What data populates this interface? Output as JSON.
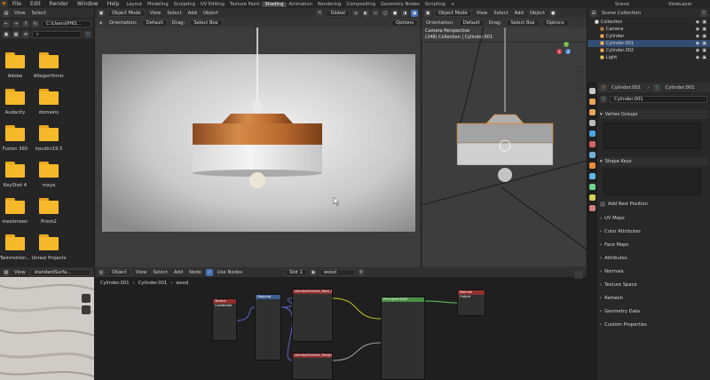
{
  "topbar": {
    "menus": [
      "File",
      "Edit",
      "Render",
      "Window",
      "Help"
    ],
    "workspaces": [
      "Layout",
      "Modeling",
      "Sculpting",
      "UV Editing",
      "Texture Paint",
      "Shading",
      "Animation",
      "Rendering",
      "Compositing",
      "Geometry Nodes",
      "Scripting"
    ],
    "active_workspace": "Shading",
    "add_tab": "+",
    "scene_label": "Scene",
    "viewlayer_label": "ViewLayer"
  },
  "filebrowser": {
    "menus": [
      "View",
      "Select"
    ],
    "path": "C:\\Users\\PHO...",
    "items": [
      {
        "label": "Adobe"
      },
      {
        "label": "Allegorithmic"
      },
      {
        "label": "Audacity"
      },
      {
        "label": "domains"
      },
      {
        "label": "Fusion 360"
      },
      {
        "label": "houdini19.5"
      },
      {
        "label": "KeyShot 4"
      },
      {
        "label": "maya"
      },
      {
        "label": "meshmixer"
      },
      {
        "label": "Prism2"
      },
      {
        "label": "Twinmotion..."
      },
      {
        "label": "Unreal Projects"
      }
    ]
  },
  "viewport1": {
    "mode": "Object Mode",
    "menus": [
      "View",
      "Select",
      "Add",
      "Object"
    ],
    "orientation_label": "Orientation:",
    "orientation": "Default",
    "drag_label": "Drag:",
    "drag": "Select Box",
    "transform": "Global",
    "options": "Options"
  },
  "viewport2": {
    "mode": "Object Mode",
    "menus": [
      "View",
      "Select",
      "Add",
      "Object"
    ],
    "orientation_label": "Orientation:",
    "orientation": "Default",
    "drag_label": "Drag:",
    "drag": "Select Box",
    "options": "Options",
    "camera_text": "Camera Perspective",
    "collection_text": "(246) Collection | Cylinder.001",
    "gizmo": {
      "x": "X",
      "y": "Y",
      "z": "Z"
    }
  },
  "outliner": {
    "title": "Scene Collection",
    "rows": [
      {
        "label": "Collection",
        "selected": false
      },
      {
        "label": "Camera",
        "selected": false
      },
      {
        "label": "Cylinder",
        "selected": false
      },
      {
        "label": "Cylinder.001",
        "selected": true
      },
      {
        "label": "Cylinder.002",
        "selected": false
      },
      {
        "label": "Light",
        "selected": false
      }
    ]
  },
  "properties": {
    "breadcrumb_object": "Cylinder.001",
    "breadcrumb_data": "Cylinder.001",
    "data_name": "Cylinder.001",
    "vertex_groups": "Vertex Groups",
    "shape_keys": "Shape Keys",
    "add_rest_position": "Add Rest Position",
    "panels": [
      "UV Maps",
      "Color Attributes",
      "Face Maps",
      "Attributes",
      "Normals",
      "Texture Space",
      "Remesh",
      "Geometry Data",
      "Custom Properties"
    ]
  },
  "image_editor": {
    "menus": [
      "View"
    ],
    "image_name": "standardSurfa..."
  },
  "node_editor": {
    "type": "Object",
    "menus": [
      "View",
      "Select",
      "Add",
      "Node"
    ],
    "use_nodes": "Use Nodes",
    "slot": "Slot 1",
    "material": "wood",
    "breadcrumb": [
      "Cylinder.001",
      "Cylinder.001",
      "wood"
    ],
    "nodes": {
      "texcoord": "Texture Coordinate",
      "mapping": "Mapping",
      "img1": "standardSurface_Base_Col...",
      "img2": "standardSurface_Roughness...",
      "bsdf": "Principled BSDF",
      "output": "Material Output"
    }
  },
  "colors": {
    "accent": "#4772b3",
    "selection": "#334d72",
    "folder": "#f5b92a",
    "wood": "#b86a30",
    "bsdf_header": "#4a8f45",
    "image_header": "#8f2f2f"
  }
}
